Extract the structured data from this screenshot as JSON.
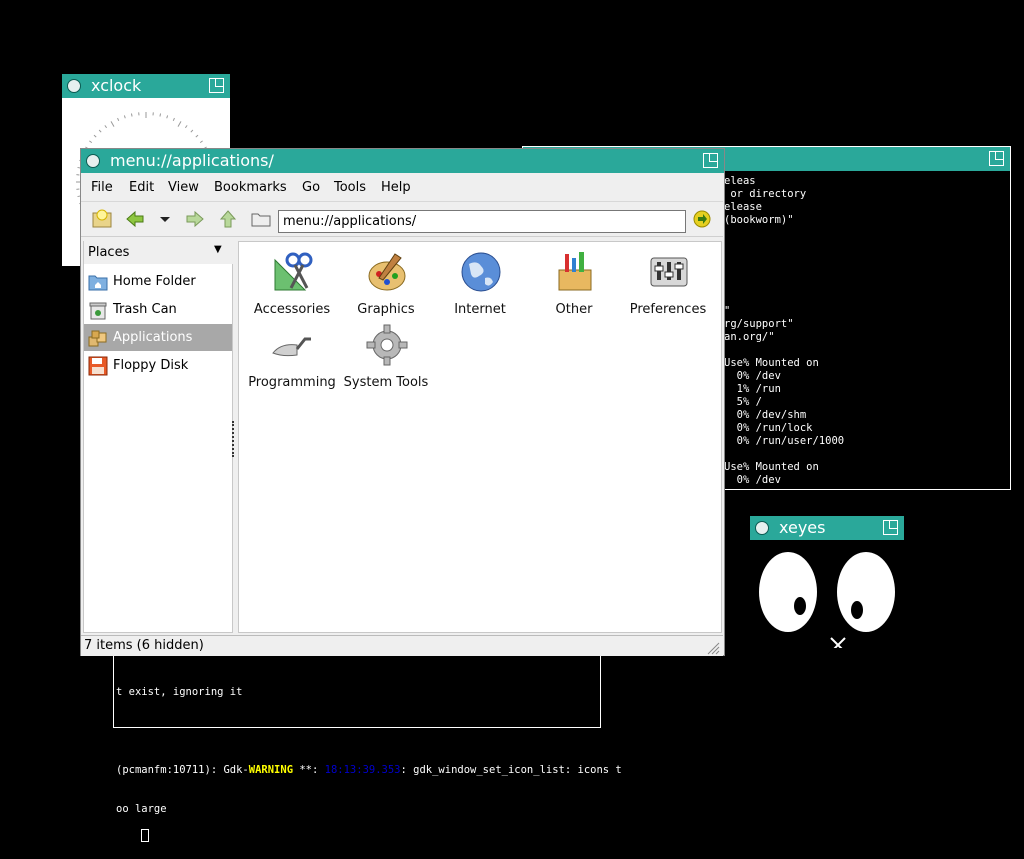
{
  "xclock": {
    "title": "xclock"
  },
  "term2": {
    "lines": [
      "eleas",
      " or directory",
      "elease",
      "(bookworm)\"",
      "",
      "",
      "",
      "",
      "",
      "",
      "\"",
      "rg/support\"",
      "an.org/\"",
      "",
      "Use% Mounted on",
      "  0% /dev",
      "  1% /run",
      "  5% /",
      "  0% /dev/shm",
      "  0% /run/lock",
      "  0% /run/user/1000",
      "",
      "Use% Mounted on",
      "  0% /dev"
    ]
  },
  "term3": {
    "line1": "t exist, ignoring it",
    "line2_pre": "(pcmanfm:10711): Gdk-",
    "line2_warn": "WARNING",
    "line2_mid": " **: ",
    "line2_time": "18:13:39.353",
    "line2_post": ": gdk_window_set_icon_list: icons t",
    "line3": "oo large"
  },
  "xeyes": {
    "title": "xeyes"
  },
  "fm": {
    "title": "menu://applications/",
    "menu": [
      "File",
      "Edit",
      "View",
      "Bookmarks",
      "Go",
      "Tools",
      "Help"
    ],
    "address": "menu://applications/",
    "places_header": "Places",
    "places": [
      {
        "label": "Home Folder",
        "icon": "home-folder-icon"
      },
      {
        "label": "Trash Can",
        "icon": "trash-can-icon"
      },
      {
        "label": "Applications",
        "icon": "applications-icon",
        "selected": true
      },
      {
        "label": "Floppy Disk",
        "icon": "floppy-disk-icon"
      }
    ],
    "apps": [
      {
        "label": "Accessories",
        "icon": "accessories-icon"
      },
      {
        "label": "Graphics",
        "icon": "graphics-icon"
      },
      {
        "label": "Internet",
        "icon": "internet-globe-icon"
      },
      {
        "label": "Other",
        "icon": "other-icon"
      },
      {
        "label": "Preferences",
        "icon": "preferences-icon"
      },
      {
        "label": "Programming",
        "icon": "programming-trowel-icon"
      },
      {
        "label": "System Tools",
        "icon": "system-tools-gear-icon"
      }
    ],
    "status": "7 items (6 hidden)"
  },
  "colors": {
    "titlebar": "#2aa89a",
    "selection": "#a8a8a8",
    "warning": "#ffff00",
    "timestamp": "#0000cc"
  }
}
